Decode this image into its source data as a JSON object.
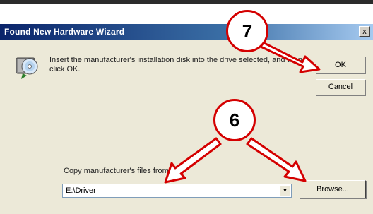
{
  "window": {
    "title": "Found New Hardware Wizard",
    "close_glyph": "x"
  },
  "dialog": {
    "message": "Insert the manufacturer's installation disk into the drive selected, and then click OK.",
    "copy_label": "Copy manufacturer's files from:",
    "path_value": "E:\\Driver",
    "ok_label": "OK",
    "cancel_label": "Cancel",
    "browse_label": "Browse..."
  },
  "callouts": {
    "step7": "7",
    "step6": "6"
  },
  "colors": {
    "callout_border": "#d40000",
    "arrow_fill": "#ffffff",
    "arrow_stroke": "#d40000",
    "titlebar_start": "#0a246a",
    "titlebar_end": "#a6caf0"
  },
  "icons": {
    "disk": "install-disk-icon",
    "combo_arrow": "chevron-down-icon"
  }
}
